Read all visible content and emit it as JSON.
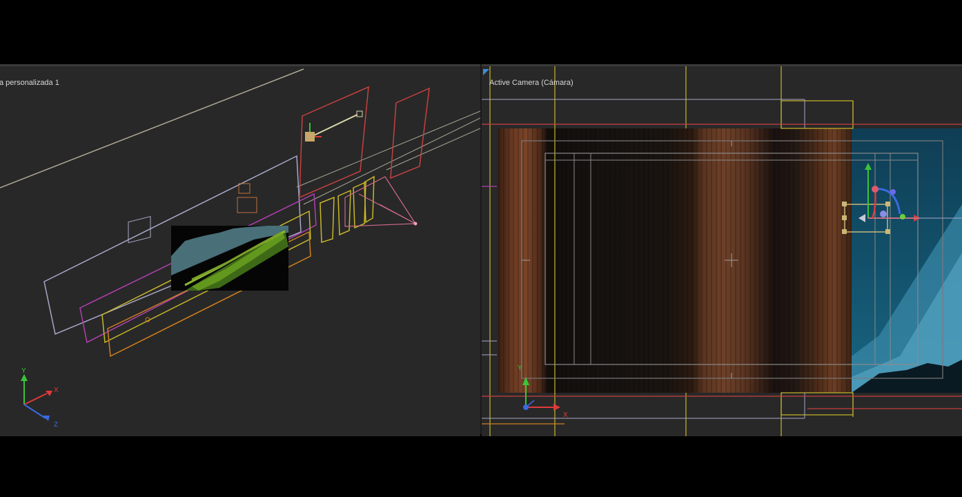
{
  "viewports": {
    "left": {
      "label": "a personalizada 1"
    },
    "right": {
      "label": "Active Camera (Cámara)"
    }
  },
  "axis_gizmo": {
    "left": {
      "x": "X",
      "y": "Y",
      "z": "Z"
    },
    "right": {
      "x": "X",
      "y": "Y"
    }
  },
  "colors": {
    "background": "#282828",
    "frame": "#000000",
    "gizmo_x": "#e03a3a",
    "gizmo_y": "#3ac43a",
    "gizmo_z": "#3a6ae0",
    "camera_frame_yellow": "#c8b828",
    "layer_purple": "#b040b0",
    "layer_orange": "#d08020",
    "layer_red": "#c84040",
    "layer_grey": "#a8a8c8"
  }
}
